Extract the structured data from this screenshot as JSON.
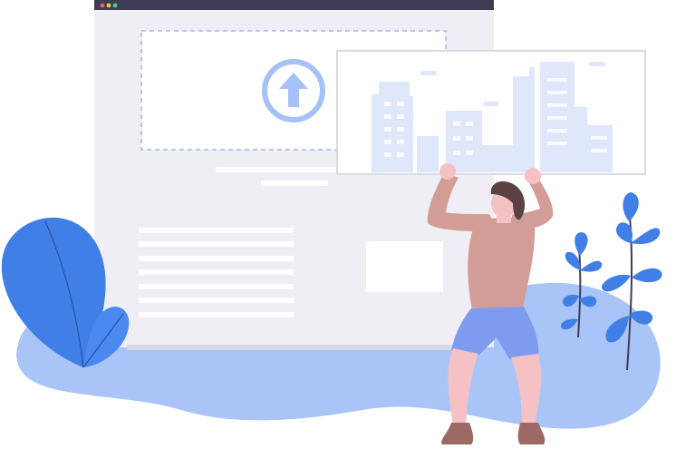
{
  "illustration": {
    "colors": {
      "accent": "#3f7fe6",
      "accent_dark": "#2f6ad6",
      "blob": "#a9c5f7",
      "window_bg": "#efeef4",
      "window_bar": "#3f3d56",
      "upload_ring": "#a6c1f6",
      "skin": "#f6c1c4",
      "shirt": "#d39d97",
      "shorts": "#7f9bef",
      "hair": "#5a4243",
      "shoes": "#9c6a64",
      "city": "#dfe7fb"
    },
    "icons": {
      "upload": "upload-arrow-icon",
      "window_controls": [
        "close-dot-icon",
        "minimize-dot-icon",
        "maximize-dot-icon"
      ]
    }
  }
}
